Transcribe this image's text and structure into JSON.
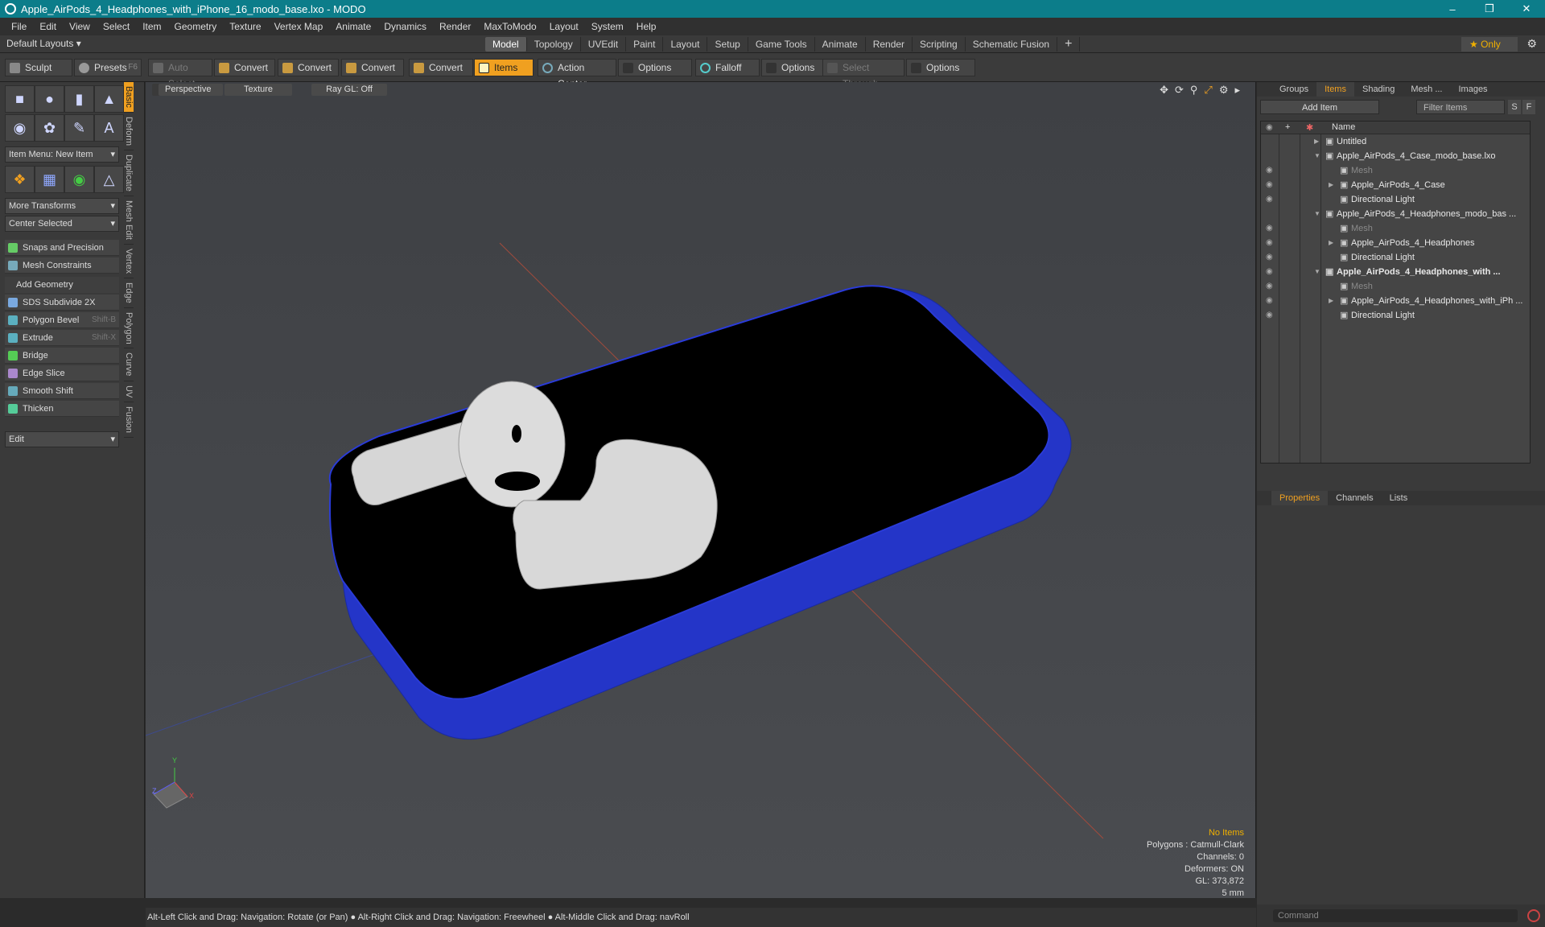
{
  "window": {
    "title": "Apple_AirPods_4_Headphones_with_iPhone_16_modo_base.lxo - MODO",
    "buttons": [
      "–",
      "❒",
      "✕"
    ]
  },
  "menu": [
    "File",
    "Edit",
    "View",
    "Select",
    "Item",
    "Geometry",
    "Texture",
    "Vertex Map",
    "Animate",
    "Dynamics",
    "Render",
    "MaxToModo",
    "Layout",
    "System",
    "Help"
  ],
  "layoutbar": {
    "layouts": "Default Layouts ▾",
    "tabs": [
      "Model",
      "Topology",
      "UVEdit",
      "Paint",
      "Layout",
      "Setup",
      "Game Tools",
      "Animate",
      "Render",
      "Scripting",
      "Schematic Fusion"
    ],
    "add": "+",
    "only": "★ Only",
    "gear": "⚙"
  },
  "toolbar": {
    "sculpt": "Sculpt",
    "presets": "Presets",
    "presets_key": "F6",
    "auto_select": "Auto Select",
    "convert": "Convert",
    "items": "Items",
    "action_center": "Action Center",
    "options": "Options",
    "falloff": "Falloff",
    "select_through": "Select Through"
  },
  "leftpanel": {
    "item_menu": "Item Menu: New Item",
    "more_transforms": "More Transforms",
    "center_selected": "Center Selected",
    "snaps": "Snaps and Precision",
    "mesh_constraints": "Mesh Constraints",
    "add_geometry": "Add Geometry",
    "tools": [
      {
        "label": "SDS Subdivide 2X",
        "shortcut": ""
      },
      {
        "label": "Polygon Bevel",
        "shortcut": "Shift-B"
      },
      {
        "label": "Extrude",
        "shortcut": "Shift-X"
      },
      {
        "label": "Bridge",
        "shortcut": ""
      },
      {
        "label": "Edge Slice",
        "shortcut": ""
      },
      {
        "label": "Smooth Shift",
        "shortcut": ""
      },
      {
        "label": "Thicken",
        "shortcut": ""
      }
    ],
    "edit": "Edit",
    "vtabs": [
      "Basic",
      "Deform",
      "Duplicate",
      "Mesh Edit",
      "Vertex",
      "Edge",
      "Polygon",
      "Curve",
      "UV",
      "Fusion"
    ]
  },
  "viewport": {
    "perspective": "Perspective",
    "texture": "Texture",
    "raygl": "Ray GL: Off",
    "info": {
      "no_items": "No Items",
      "polygons": "Polygons : Catmull-Clark",
      "channels": "Channels: 0",
      "deformers": "Deformers: ON",
      "gl": "GL: 373,872",
      "scale": "5 mm"
    },
    "axis": {
      "x": "X",
      "y": "Y",
      "z": "Z"
    }
  },
  "rightpanel": {
    "top_tabs": [
      "Groups",
      "Items",
      "Shading",
      "Mesh ...",
      "Images"
    ],
    "add_item": "Add Item",
    "filter_items": "Filter Items",
    "s_btn": "S",
    "f_btn": "F",
    "column_name": "Name",
    "items": [
      {
        "label": "Untitled",
        "indent": 0,
        "arrow": "▶",
        "eye": false,
        "bold": false,
        "dim": false
      },
      {
        "label": "Apple_AirPods_4_Case_modo_base.lxo",
        "indent": 0,
        "arrow": "▼",
        "eye": false,
        "bold": false,
        "dim": false
      },
      {
        "label": "Mesh",
        "indent": 1,
        "arrow": "",
        "eye": true,
        "bold": false,
        "dim": true
      },
      {
        "label": "Apple_AirPods_4_Case",
        "indent": 1,
        "arrow": "▶",
        "eye": true,
        "bold": false,
        "dim": false
      },
      {
        "label": "Directional Light",
        "indent": 1,
        "arrow": "",
        "eye": true,
        "bold": false,
        "dim": false
      },
      {
        "label": "Apple_AirPods_4_Headphones_modo_bas ...",
        "indent": 0,
        "arrow": "▼",
        "eye": false,
        "bold": false,
        "dim": false
      },
      {
        "label": "Mesh",
        "indent": 1,
        "arrow": "",
        "eye": true,
        "bold": false,
        "dim": true
      },
      {
        "label": "Apple_AirPods_4_Headphones",
        "indent": 1,
        "arrow": "▶",
        "eye": true,
        "bold": false,
        "dim": false
      },
      {
        "label": "Directional Light",
        "indent": 1,
        "arrow": "",
        "eye": true,
        "bold": false,
        "dim": false
      },
      {
        "label": "Apple_AirPods_4_Headphones_with ...",
        "indent": 0,
        "arrow": "▼",
        "eye": true,
        "bold": true,
        "dim": false
      },
      {
        "label": "Mesh",
        "indent": 1,
        "arrow": "",
        "eye": true,
        "bold": false,
        "dim": true
      },
      {
        "label": "Apple_AirPods_4_Headphones_with_iPh ...",
        "indent": 1,
        "arrow": "▶",
        "eye": true,
        "bold": false,
        "dim": false
      },
      {
        "label": "Directional Light",
        "indent": 1,
        "arrow": "",
        "eye": true,
        "bold": false,
        "dim": false
      }
    ],
    "bottom_tabs": [
      "Properties",
      "Channels",
      "Lists"
    ],
    "command": "Command"
  },
  "statusbar": "Alt-Left Click and Drag: Navigation: Rotate (or Pan) ●  Alt-Right Click and Drag: Navigation: Freewheel ●  Alt-Middle Click and Drag: navRoll"
}
